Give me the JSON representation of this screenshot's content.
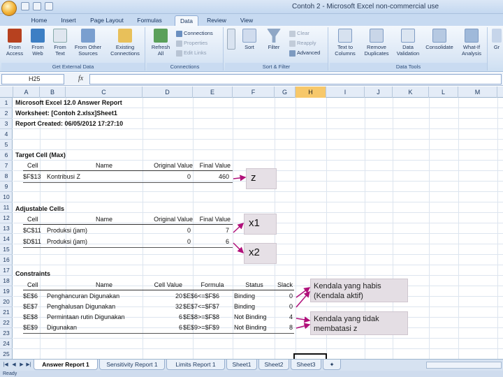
{
  "title": "Contoh 2 - Microsoft Excel non-commercial use",
  "tabs": [
    "Home",
    "Insert",
    "Page Layout",
    "Formulas",
    "Data",
    "Review",
    "View"
  ],
  "active_tab": "Data",
  "ribbon": {
    "groups": [
      "Get External Data",
      "Connections",
      "Sort & Filter",
      "Data Tools",
      ""
    ],
    "from_access": "From Access",
    "from_web": "From Web",
    "from_text": "From Text",
    "from_other": "From Other Sources",
    "existing_connections": "Existing Connections",
    "refresh_all": "Refresh All",
    "connections": "Connections",
    "properties": "Properties",
    "edit_links": "Edit Links",
    "sort_az": "",
    "sort": "Sort",
    "filter": "Filter",
    "clear": "Clear",
    "reapply": "Reapply",
    "advanced": "Advanced",
    "text_to_columns": "Text to Columns",
    "remove_duplicates": "Remove Duplicates",
    "data_validation": "Data Validation",
    "consolidate": "Consolidate",
    "what_if": "What-If Analysis",
    "group": "Gr"
  },
  "formula_bar": {
    "name_box": "H25",
    "fx": "fx",
    "value": ""
  },
  "columns": [
    "A",
    "B",
    "C",
    "D",
    "E",
    "F",
    "G",
    "H",
    "I",
    "J",
    "K",
    "L",
    "M"
  ],
  "selected_column": "H",
  "rows": [
    "1",
    "2",
    "3",
    "4",
    "5",
    "6",
    "7",
    "8",
    "9",
    "10",
    "11",
    "12",
    "13",
    "14",
    "15",
    "16",
    "17",
    "18",
    "19",
    "20",
    "21",
    "22",
    "23",
    "24",
    "25"
  ],
  "report": {
    "line1": "Microsoft Excel 12.0 Answer Report",
    "line2": "Worksheet: [Contoh 2.xlsx]Sheet1",
    "line3": "Report Created: 06/05/2012 17:27:10",
    "target_title": "Target Cell (Max)",
    "adjustable_title": "Adjustable Cells",
    "constraints_title": "Constraints",
    "hdr_cell": "Cell",
    "hdr_name": "Name",
    "hdr_original": "Original Value",
    "hdr_final": "Final Value",
    "hdr_cell_value": "Cell Value",
    "hdr_formula": "Formula",
    "hdr_status": "Status",
    "hdr_slack": "Slack",
    "target": {
      "cell": "$F$13",
      "name": "Kontribusi Z",
      "original": "0",
      "final": "460"
    },
    "adjustable": [
      {
        "cell": "$C$11",
        "name": "Produksi (jam)",
        "original": "0",
        "final": "7"
      },
      {
        "cell": "$D$11",
        "name": "Produksi (jam)",
        "original": "0",
        "final": "6"
      }
    ],
    "constraints": [
      {
        "cell": "$E$6",
        "name": "Penghancuran Digunakan",
        "value": "20",
        "formula": "$E$6<=$F$6",
        "status": "Binding",
        "slack": "0"
      },
      {
        "cell": "$E$7",
        "name": "Penghalusan Digunakan",
        "value": "32",
        "formula": "$E$7<=$F$7",
        "status": "Binding",
        "slack": "0"
      },
      {
        "cell": "$E$8",
        "name": "Permintaan rutin Digunakan",
        "value": "6",
        "formula": "$E$8>=$F$8",
        "status": "Not Binding",
        "slack": "4"
      },
      {
        "cell": "$E$9",
        "name": "Digunakan",
        "value": "6",
        "formula": "$E$9>=$F$9",
        "status": "Not Binding",
        "slack": "8"
      }
    ]
  },
  "annotations": {
    "z": "z",
    "x1": "x1",
    "x2": "x2",
    "binding_note": "Kendala yang habis (Kendala aktif)",
    "nonbinding_note": "Kendala yang tidak membatasi z",
    "arrow_color": "#b0107a",
    "box_color": "#e6e0e6"
  },
  "sheet_tabs": [
    "Answer Report 1",
    "Sensitivity Report 1",
    "Limits Report 1",
    "Sheet1",
    "Sheet2",
    "Sheet3"
  ],
  "active_sheet": "Answer Report 1",
  "status": "Ready"
}
